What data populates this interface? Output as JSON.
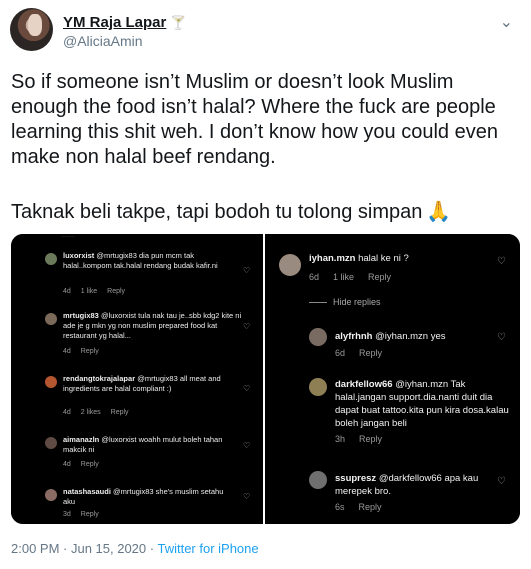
{
  "header": {
    "display_name": "YM Raja Lapar",
    "handle": "@AliciaAmin",
    "name_emoji": "🍸",
    "menu_icon": "chevron-down-icon"
  },
  "tweet": {
    "text_line1": "So if someone isn’t Muslim or doesn’t look Muslim enough the food isn’t halal? Where the fuck are people learning this shit weh. I don’t know how you could even make non halal beef rendang.",
    "text_line2": "Taknak beli takpe, tapi bodoh tu tolong simpan",
    "emoji": "🙏"
  },
  "left_comments": [
    {
      "user": "luxorxist",
      "text": "@mrtugix83 dia pun mcm tak halal..kompom tak.halal rendang budak kafir.ni",
      "time": "4d",
      "likes": "1 like",
      "reply": "Reply"
    },
    {
      "user": "mrtugix83",
      "text": "@luxorxist tula nak tau je..sbb kdg2 kite ni ade je g mkn yg non muslim prepared food kat restaurant yg halal...",
      "time": "4d",
      "likes": "",
      "reply": "Reply"
    },
    {
      "user": "rendangtokrajalapar",
      "text": "@mrtugix83 all meat and ingredients are halal compliant :)",
      "time": "4d",
      "likes": "2 likes",
      "reply": "Reply"
    },
    {
      "user": "aimanazln",
      "text": "@luxorxist woahh mulut boleh tahan makcik ni",
      "time": "4d",
      "likes": "",
      "reply": "Reply"
    },
    {
      "user": "natashasaudi",
      "text": "@mrtugix83 she's muslim setahu aku",
      "time": "3d",
      "likes": "",
      "reply": "Reply"
    }
  ],
  "right_comments": {
    "top": {
      "user": "iyhan.mzn",
      "text": "halal ke ni ?",
      "time": "6d",
      "likes": "1 like",
      "reply": "Reply"
    },
    "hide_replies": "Hide replies",
    "replies": [
      {
        "user": "alyfrhnh",
        "text": "@iyhan.mzn yes",
        "time": "6d",
        "reply": "Reply"
      },
      {
        "user": "darkfellow66",
        "text": "@iyhan.mzn Tak halal.jangan support.dia.nanti duit dia dapat buat tattoo.kita pun kira dosa.kalau boleh jangan beli",
        "time": "3h",
        "reply": "Reply"
      },
      {
        "user": "ssupresz",
        "text": "@darkfellow66 apa kau merepek bro.",
        "time": "6s",
        "reply": "Reply"
      }
    ]
  },
  "footer": {
    "timestamp": "2:00 PM · Jun 15, 2020 · ",
    "source": "Twitter for iPhone"
  },
  "colors": {
    "link": "#1da1f2",
    "muted": "#657786",
    "media_bg": "#000000"
  }
}
